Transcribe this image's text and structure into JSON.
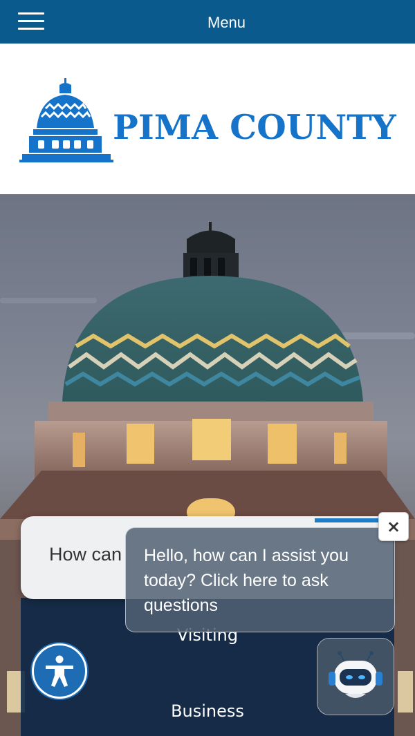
{
  "header": {
    "menu_label": "Menu"
  },
  "logo": {
    "text": "PIMA COUNTY",
    "brand_color": "#1574c9"
  },
  "chat": {
    "input_placeholder": "How can",
    "bubble_text": "Hello, how can I assist you today? Click here to ask questions",
    "close_label": "×"
  },
  "nav": {
    "items": [
      "Visiting",
      "Business"
    ]
  },
  "colors": {
    "topbar": "#0b5a8e",
    "accessibility": "#1e6cb3"
  },
  "icons": [
    "hamburger-icon",
    "accessibility-icon",
    "chatbot-robot-icon",
    "close-icon"
  ]
}
